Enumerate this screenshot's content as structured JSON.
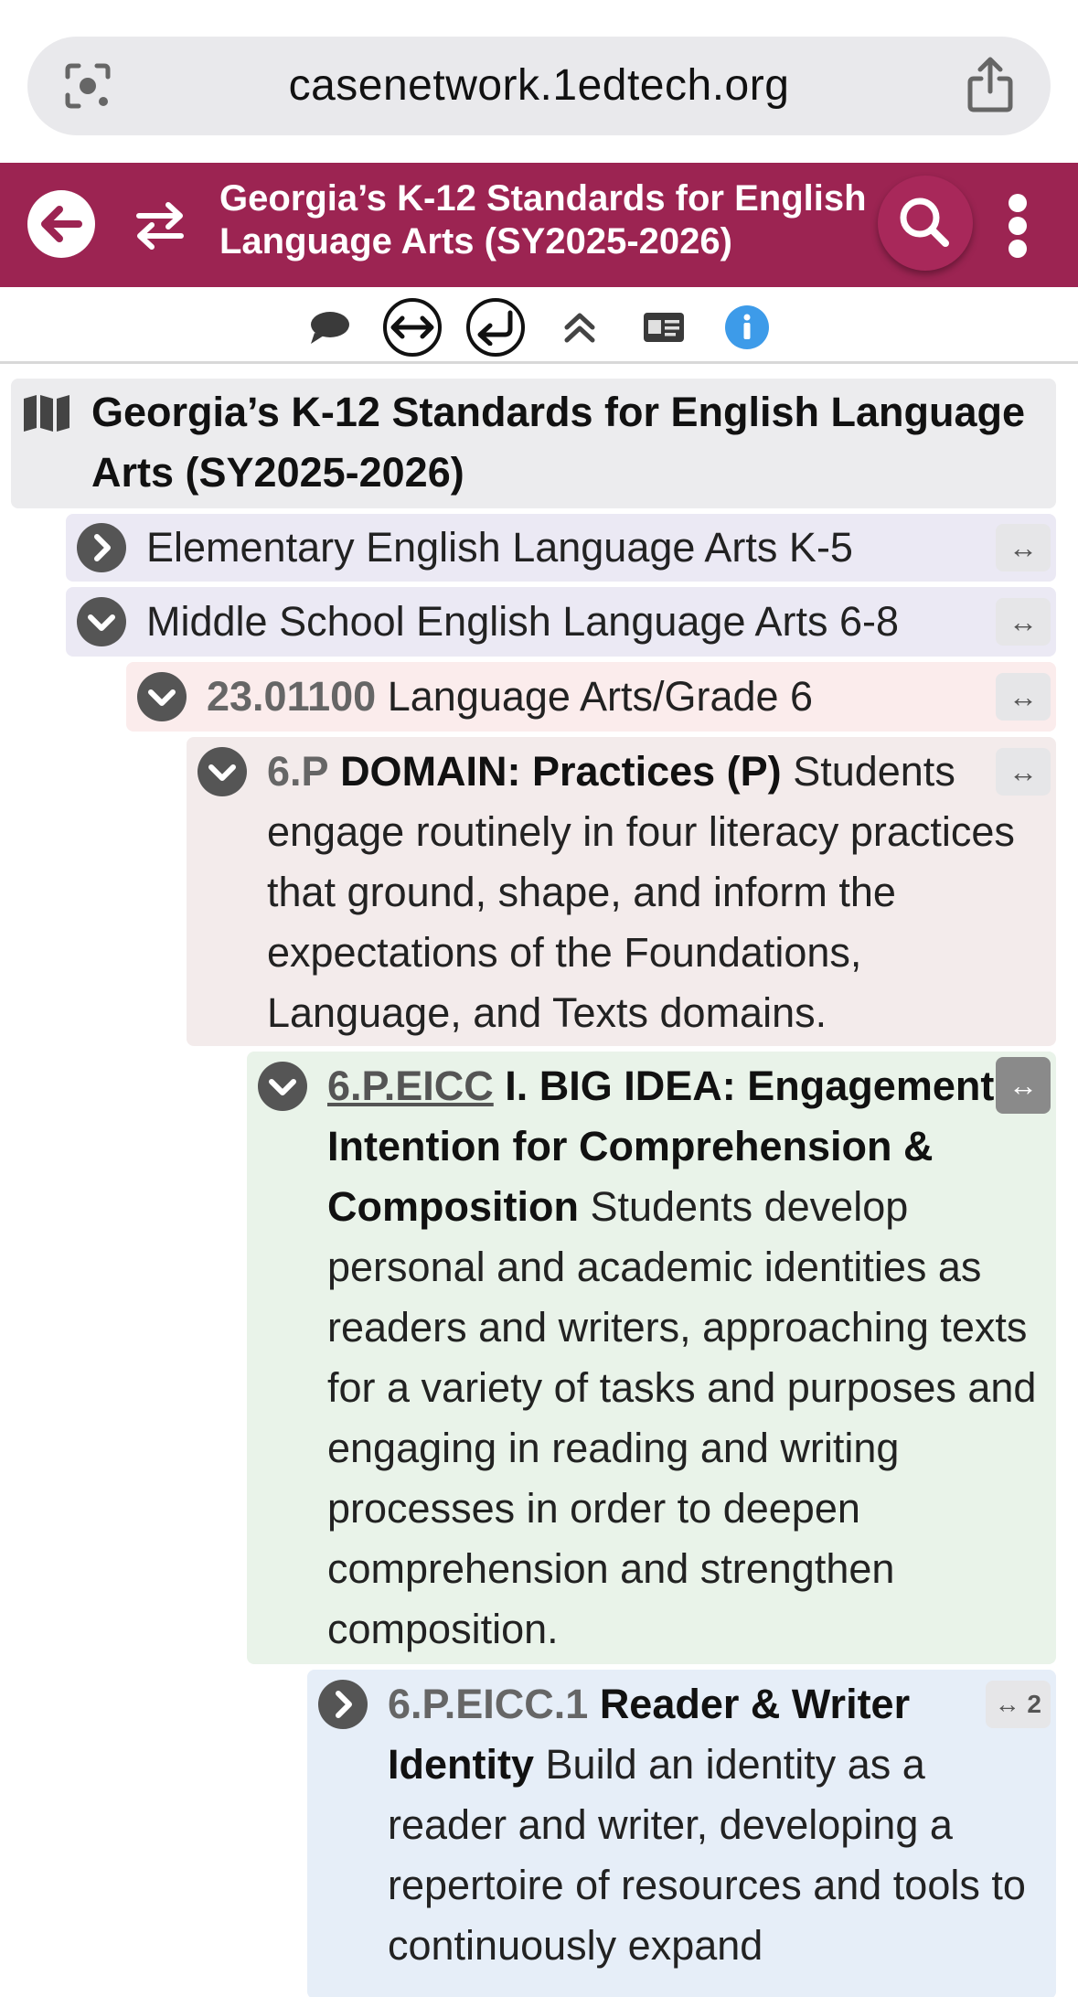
{
  "browser": {
    "url": "casenetwork.1edtech.org",
    "lens_icon": "camera-lens-icon",
    "share_icon": "share-icon"
  },
  "appbar": {
    "title": "Georgia’s K-12 Standards for English Language Arts (SY2025-2026)",
    "back_icon": "arrow-left-icon",
    "swap_icon": "swap-arrows-icon",
    "search_icon": "search-icon",
    "menu_icon": "kebab-menu-icon",
    "color": "#9c2452"
  },
  "toolbar": {
    "items": [
      "comment-icon",
      "expand-horizontal-icon",
      "return-icon",
      "collapse-all-icon",
      "id-card-icon",
      "info-icon"
    ]
  },
  "tree": {
    "root": {
      "icon": "map-icon",
      "title": "Georgia’s K-12 Standards for English Language Arts (SY2025-2026)"
    },
    "elementary": {
      "label": "Elementary English Language Arts K-5",
      "assoc": "↔"
    },
    "middle": {
      "label": "Middle School English Language Arts 6-8",
      "assoc": "↔"
    },
    "grade6": {
      "code": "23.01100",
      "label": "Language Arts/Grade 6",
      "assoc": "↔"
    },
    "domain": {
      "code": "6.P",
      "heading": "DOMAIN: Practices (P)",
      "text": "Students engage routinely in four literacy practices that ground, shape, and inform the expectations of the Foundations, Language, and Texts domains.",
      "assoc": "↔"
    },
    "bigidea": {
      "code": "6.P.EICC",
      "heading": "I. BIG IDEA: Engagement Intention for Comprehension & Composition",
      "text": "Students develop personal and academic identities as readers and writers, approaching texts for a variety of tasks and purposes and engaging in reading and writing processes in order to deepen comprehension and strengthen composition.",
      "assoc": "↔"
    },
    "standard": {
      "code": "6.P.EICC.1",
      "heading": "Reader & Writer Identity",
      "text": "Build an identity as a reader and writer, developing a repertoire of resources and tools to continuously expand",
      "assoc": "↔ 2"
    }
  },
  "colors": {
    "root_bg": "#ececee",
    "level1_bg": "#ebe9f4",
    "grade_bg": "#fbecec",
    "domain_bg": "#f3ebeb",
    "bigidea_bg": "#e9f3e9",
    "standard_bg": "#e6eef8"
  }
}
